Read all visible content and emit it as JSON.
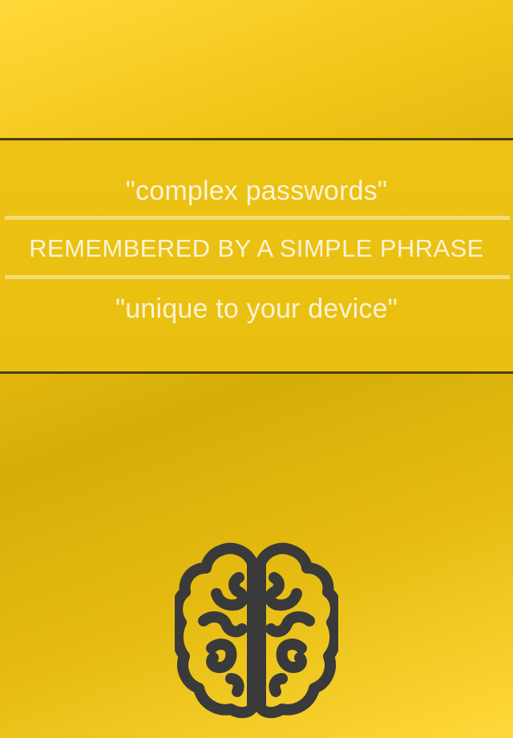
{
  "banner": {
    "line_top": "\"complex passwords\"",
    "line_middle": "REMEMBERED BY A SIMPLE PHRASE",
    "line_bottom": "\"unique to your device\""
  },
  "icons": {
    "brain": "brain-icon"
  },
  "colors": {
    "background_gold": "#e6bc12",
    "band_gold": "#ecc214",
    "border_dark": "#4a3f1c",
    "text_light": "#fbf3d6",
    "icon_dark": "#3a3a3a"
  }
}
